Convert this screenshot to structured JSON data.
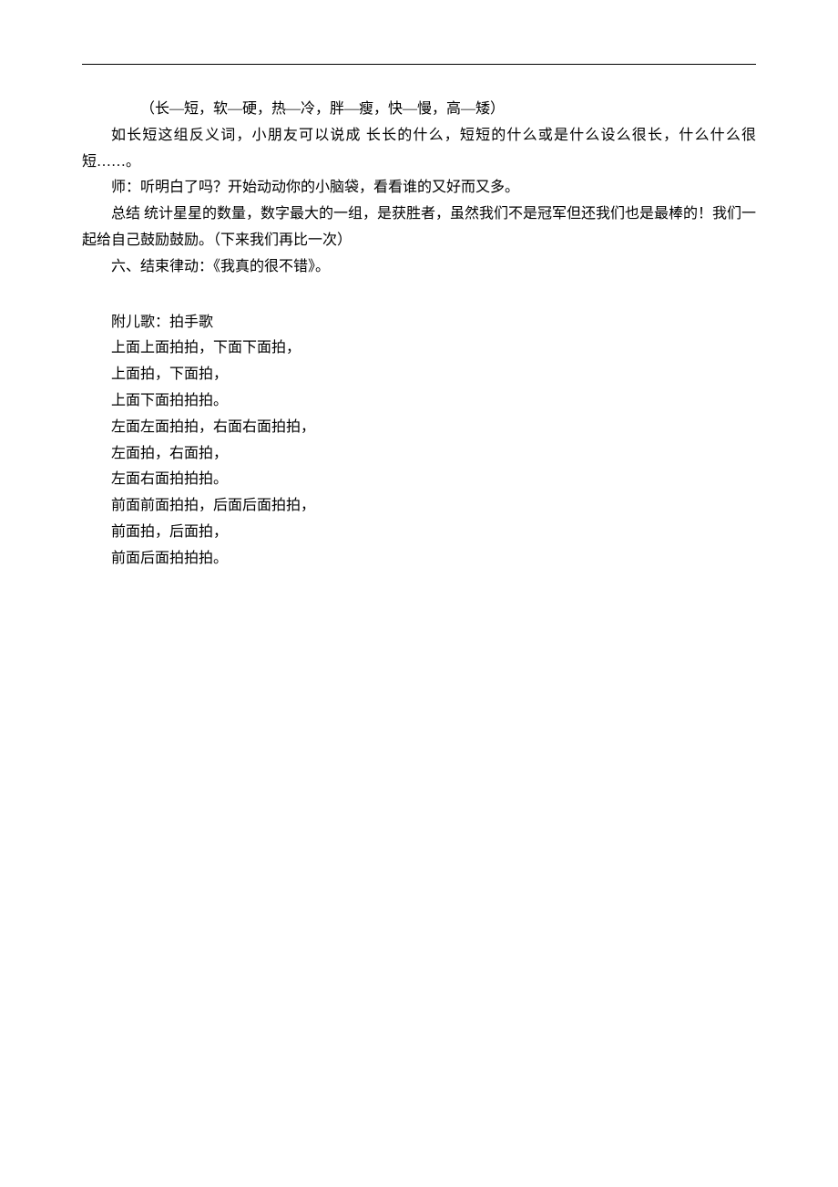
{
  "lines": [
    {
      "cls": "indent-2",
      "text": "（长—短，软—硬，热—冷，胖—瘦，快—慢，高—矮）"
    },
    {
      "cls": "indent-1",
      "text": "如长短这组反义词，小朋友可以说成 长长的什么，短短的什么或是什么设么很长，什么什么很短……。"
    },
    {
      "cls": "indent-1",
      "text": "师：听明白了吗？开始动动你的小脑袋，看看谁的又好而又多。"
    },
    {
      "cls": "indent-1",
      "text": "总结 统计星星的数量，数字最大的一组，是获胜者，虽然我们不是冠军但还我们也是最棒的！我们一起给自己鼓励鼓励。（下来我们再比一次）"
    },
    {
      "cls": "indent-1",
      "text": "六、结束律动：《我真的很不错》。"
    }
  ],
  "song_title": "附儿歌：拍手歌",
  "song_lines": [
    "上面上面拍拍，下面下面拍，",
    "上面拍，下面拍，",
    "上面下面拍拍拍。",
    "左面左面拍拍，右面右面拍拍，",
    "左面拍，右面拍，",
    "左面右面拍拍拍。",
    "前面前面拍拍，后面后面拍拍，",
    "前面拍，后面拍，",
    "前面后面拍拍拍。"
  ]
}
